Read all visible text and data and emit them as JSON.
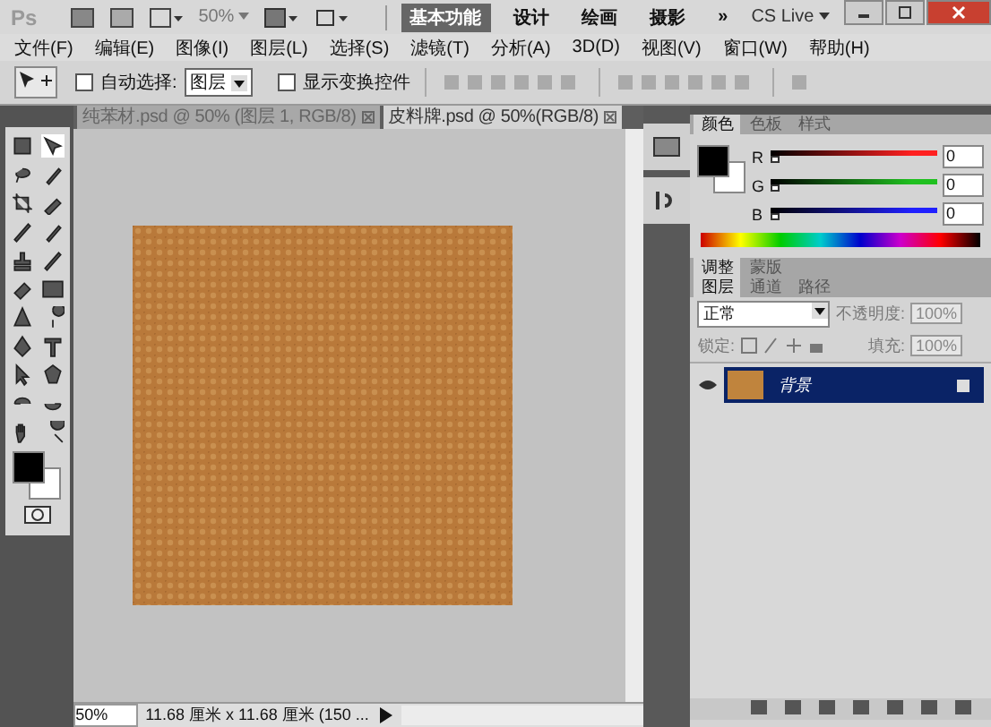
{
  "app_bar": {
    "logo": "Ps",
    "zoom": "50%",
    "workspaces": [
      {
        "label": "基本功能",
        "selected": true
      },
      {
        "label": "设计",
        "selected": false
      },
      {
        "label": "绘画",
        "selected": false
      },
      {
        "label": "摄影",
        "selected": false
      }
    ],
    "more": "»",
    "cs_live": "CS Live"
  },
  "menu": [
    "文件(F)",
    "编辑(E)",
    "图像(I)",
    "图层(L)",
    "选择(S)",
    "滤镜(T)",
    "分析(A)",
    "3D(D)",
    "视图(V)",
    "窗口(W)",
    "帮助(H)"
  ],
  "options_bar": {
    "auto_select": {
      "label": "自动选择:",
      "checked": false
    },
    "auto_select_target": "图层",
    "show_transform": {
      "label": "显示变换控件",
      "checked": false
    }
  },
  "document_tabs": [
    {
      "title": "纯苯材.psd @ 50% (图层 1, RGB/8)",
      "selected": false
    },
    {
      "title": "皮料牌.psd @ 50%(RGB/8)",
      "selected": true
    }
  ],
  "status_bar": {
    "zoom": "50%",
    "doc_info": "11.68 厘米 x 11.68 厘米 (150 ..."
  },
  "color_panel": {
    "tabs": [
      {
        "label": "颜色",
        "selected": true
      },
      {
        "label": "色板",
        "selected": false
      },
      {
        "label": "样式",
        "selected": false
      }
    ],
    "channels": [
      {
        "label": "R",
        "value": "0",
        "color": "#ff2020",
        "level": 0
      },
      {
        "label": "G",
        "value": "0",
        "color": "#20c020",
        "level": 0
      },
      {
        "label": "B",
        "value": "0",
        "color": "#2020ff",
        "level": 0
      }
    ]
  },
  "adjust_tabs": [
    {
      "label": "调整",
      "selected": true
    },
    {
      "label": "蒙版",
      "selected": false
    }
  ],
  "layers_panel": {
    "tabs": [
      {
        "label": "图层",
        "selected": true
      },
      {
        "label": "通道",
        "selected": false
      },
      {
        "label": "路径",
        "selected": false
      }
    ],
    "blend_mode": "正常",
    "opacity_label": "不透明度:",
    "opacity": "100%",
    "lock_label": "锁定:",
    "fill_label": "填充:",
    "fill": "100%",
    "layers": [
      {
        "name": "背景",
        "selected": true,
        "visible": true,
        "locked": true
      }
    ]
  }
}
